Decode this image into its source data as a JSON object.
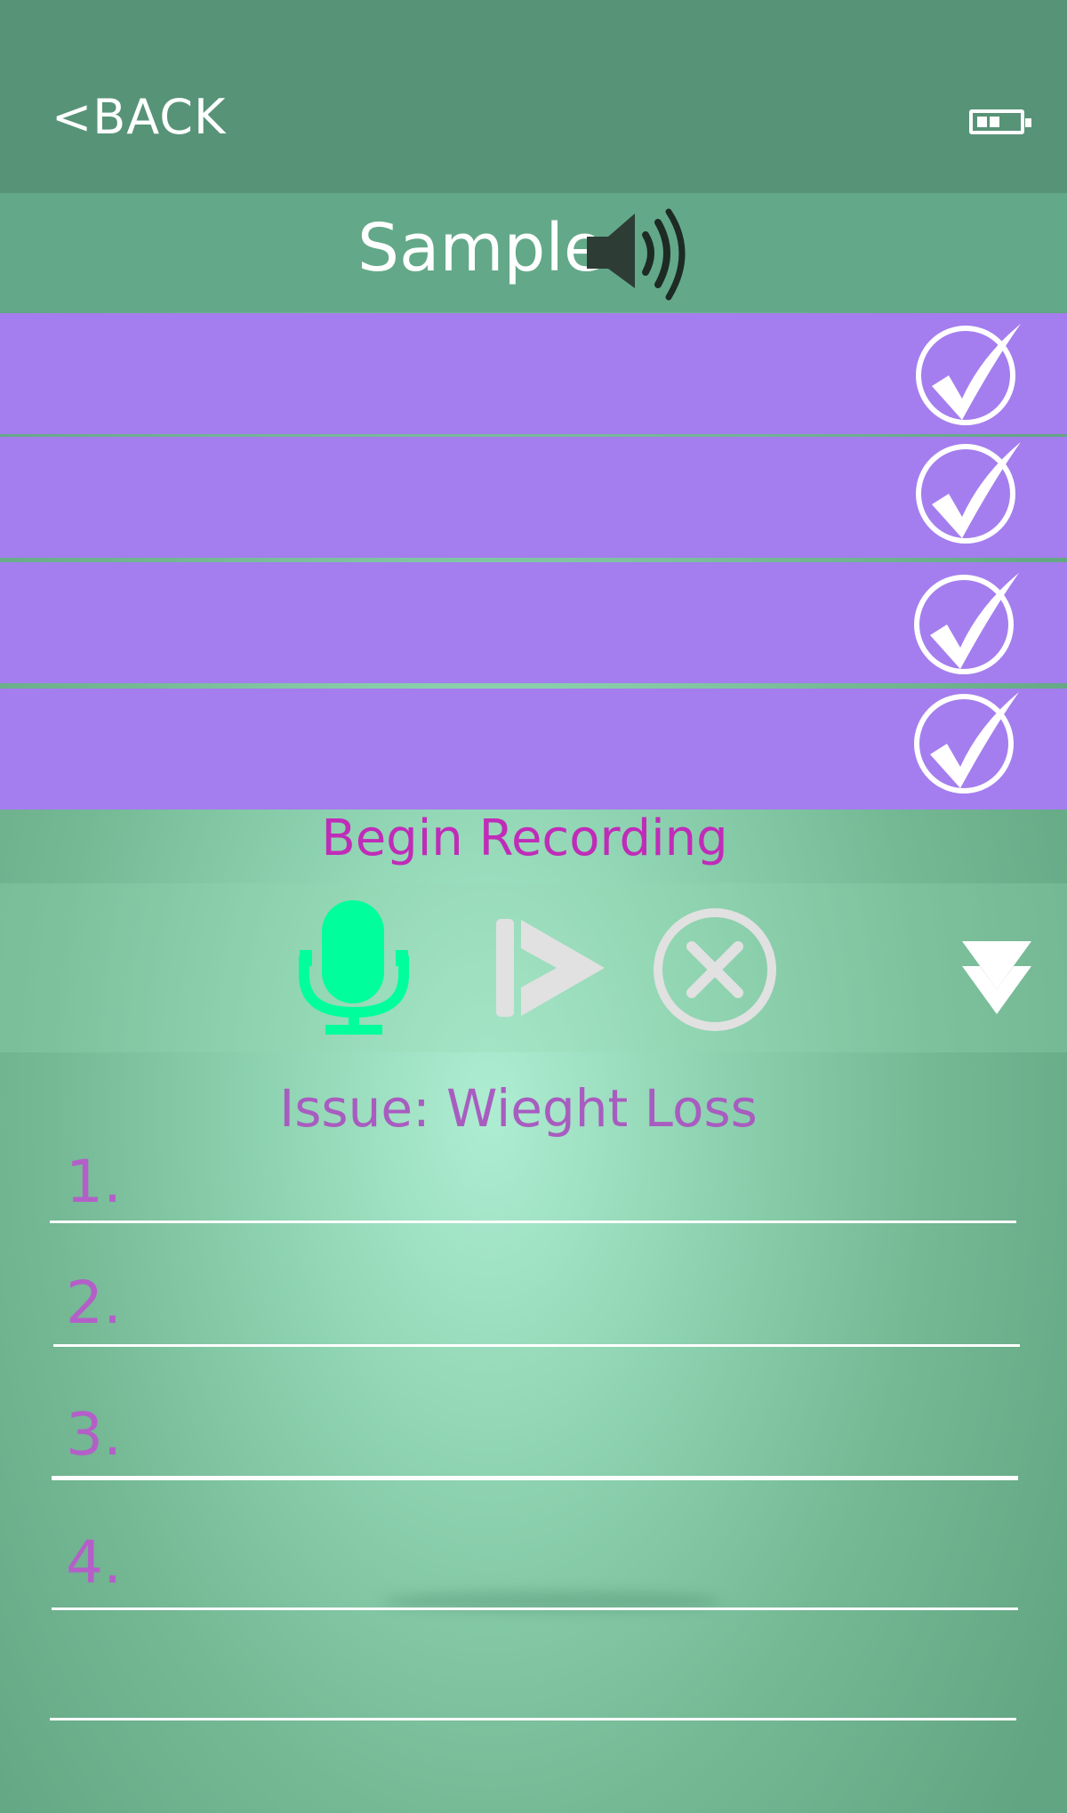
{
  "header": {
    "back_label": "<BACK",
    "battery_icon": "battery-low-icon"
  },
  "title_bar": {
    "title": "Sample",
    "speaker_icon": "speaker-volume-icon"
  },
  "options": [
    {
      "label": "",
      "checked": true
    },
    {
      "label": "",
      "checked": true
    },
    {
      "label": "",
      "checked": true
    },
    {
      "label": "",
      "checked": true
    }
  ],
  "recording": {
    "label": "Begin Recording",
    "mic_icon": "microphone-icon",
    "play_icon": "play-icon",
    "cancel_icon": "cancel-circle-icon",
    "dropdown_icon": "chevron-down-icon"
  },
  "issue": {
    "label": "Issue: Wieght Loss",
    "items": [
      "1.",
      "2.",
      "3.",
      "4."
    ]
  },
  "colors": {
    "header": "#579377",
    "title_bar": "#63a989",
    "option_row": "#a47eee",
    "record_text": "#c02cb8",
    "issue_text": "#a95cc0",
    "mic": "#00ff9c",
    "controls_gray": "#e1e1e1"
  }
}
